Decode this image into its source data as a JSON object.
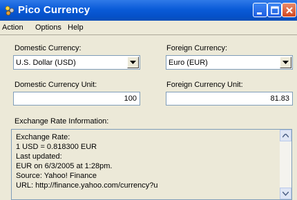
{
  "window": {
    "title": "Pico Currency"
  },
  "menu": {
    "items": [
      "Action",
      "Options",
      "Help"
    ]
  },
  "domestic": {
    "currency_label": "Domestic Currency:",
    "currency_value": "U.S. Dollar (USD)",
    "unit_label": "Domestic Currency Unit:",
    "unit_value": "100"
  },
  "foreign": {
    "currency_label": "Foreign Currency:",
    "currency_value": "Euro (EUR)",
    "unit_label": "Foreign Currency Unit:",
    "unit_value": "81.83"
  },
  "info": {
    "label": "Exchange Rate Information:",
    "lines": [
      "Exchange Rate:",
      "1 USD = 0.818300 EUR",
      "Last updated:",
      "EUR on 6/3/2005 at 1:28pm.",
      "Source: Yahoo! Finance",
      "URL: http://finance.yahoo.com/currency?u"
    ]
  },
  "colors": {
    "titlebar": "#0a5bd8",
    "window_bg": "#ece9d8",
    "close_button": "#d2471f"
  },
  "icons": [
    "app-icon",
    "minimize-icon",
    "maximize-icon",
    "close-icon",
    "dropdown-arrow-icon",
    "scroll-up-icon",
    "scroll-down-icon"
  ]
}
